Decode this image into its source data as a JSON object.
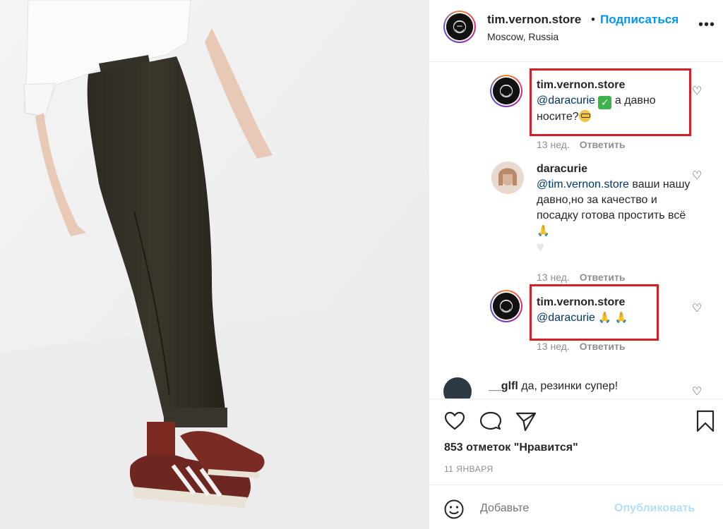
{
  "post": {
    "username": "tim.vernon.store",
    "separator": "•",
    "follow_label": "Подписаться",
    "location": "Moscow, Russia",
    "more_icon": "more-horizontal-icon"
  },
  "comments": [
    {
      "username": "tim.vernon.store",
      "mention": "@daracurie",
      "text_after_check": " а давно",
      "text_line2": "носите?",
      "time": "13 нед.",
      "reply_label": "Ответить",
      "highlighted": true
    },
    {
      "username": "daracurie",
      "mention": "@tim.vernon.store",
      "text_after_mention": " ваши нашу давно,но за качество и посадку готова простить всё",
      "time": "13 нед.",
      "reply_label": "Ответить",
      "highlighted": false
    },
    {
      "username": "tim.vernon.store",
      "mention": "@daracurie",
      "time": "13 нед.",
      "reply_label": "Ответить",
      "highlighted": true
    },
    {
      "username": "__glfl",
      "text": "да, резинки супер!"
    }
  ],
  "actions": {
    "likes_text": "853 отметок \"Нравится\"",
    "date": "11 ЯНВАРЯ",
    "icons": [
      "heart-icon",
      "comment-icon",
      "share-icon",
      "bookmark-icon"
    ]
  },
  "composer": {
    "placeholder": "Добавьте",
    "publish_label": "Опубликовать"
  },
  "colors": {
    "accent": "#0095f6",
    "highlight_box": "#d32027",
    "mention": "#00376b",
    "muted": "#8e8e8e"
  }
}
